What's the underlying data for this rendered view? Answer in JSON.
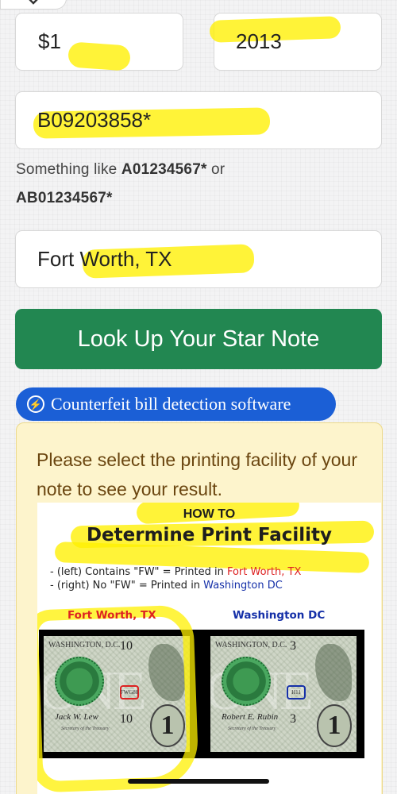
{
  "form": {
    "denomination": {
      "value": "$1"
    },
    "series_year": {
      "value": "2013"
    },
    "serial_number": {
      "value": "B09203858*"
    },
    "hint": {
      "prefix": "Something like ",
      "example1": "A01234567*",
      "middle": " or",
      "example2": "AB01234567*"
    },
    "location": {
      "value": "Fort Worth, TX"
    },
    "chevron_icon": "chevron-down-icon"
  },
  "lookup_button": {
    "label": "Look Up Your Star Note"
  },
  "counterfeit_pill": {
    "label": "Counterfeit bill detection software",
    "icon": "lightning-bolt-icon"
  },
  "result_card": {
    "message": "Please select the printing facility of your note to see your result.",
    "guide": {
      "kicker": "HOW TO",
      "title": "Determine Print Facility",
      "rule1": {
        "prefix": "- (left) Contains \"FW\" = Printed in ",
        "place": "Fort Worth, TX"
      },
      "rule2": {
        "prefix": "- (right) No \"FW\" = Printed in ",
        "place": "Washington DC"
      },
      "left_label": "Fort Worth, TX",
      "right_label": "Washington DC",
      "left_note": {
        "header": "WASHINGTON, D.C.",
        "plate_top": "10",
        "plate_bottom": "10",
        "mark": "FWG88",
        "signature": "Jack W. Lew",
        "treasury": "Secretary of the Treasury",
        "corner": "1"
      },
      "right_note": {
        "header": "WASHINGTON, D.C.",
        "plate_top": "3",
        "plate_bottom": "3",
        "mark": "H11",
        "signature": "Robert E. Rubin",
        "treasury": "Secretary of the Treasury",
        "corner": "1"
      }
    }
  },
  "colors": {
    "button_green": "#228751",
    "pill_blue": "#1b5fd6",
    "card_bg": "#fdf4cc",
    "card_text": "#6b4610",
    "highlight": "#fff000",
    "fort_worth_red": "#dd2222",
    "washington_blue": "#1530a8"
  }
}
